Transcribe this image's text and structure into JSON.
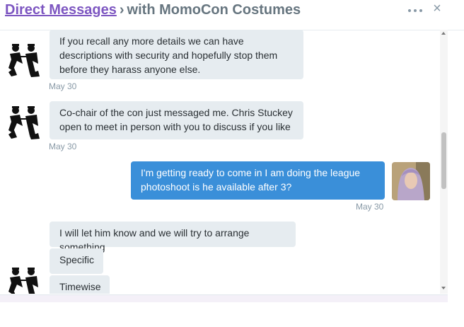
{
  "header": {
    "link": "Direct Messages",
    "separator": "›",
    "title": "with MomoCon Costumes",
    "more_icon": "ellipsis-icon",
    "close_icon": "×"
  },
  "messages": [
    {
      "id": "m1",
      "from": "other",
      "text": "If you recall any more details we can have  descriptions with security and hopefully stop them before they harass anyone else."
    },
    {
      "id": "m2",
      "from": "other",
      "text": "Co-chair of the con just messaged me. Chris Stuckey open to meet in person with you to discuss if you like"
    },
    {
      "id": "m3",
      "from": "me",
      "text": "I'm getting ready to come in I am doing the league photoshoot is he available after 3?"
    },
    {
      "id": "m4",
      "from": "other",
      "text": "I will let him know and we will try to arrange something"
    },
    {
      "id": "m5",
      "from": "other",
      "text": "Specific"
    },
    {
      "id": "m6",
      "from": "other",
      "text": "Timewise"
    }
  ],
  "timestamps": [
    "May 30",
    "May 30",
    "May 30"
  ],
  "colors": {
    "accent": "#3a8fd9",
    "link": "#7d56c1",
    "bubble_other": "#e6ecf0"
  }
}
